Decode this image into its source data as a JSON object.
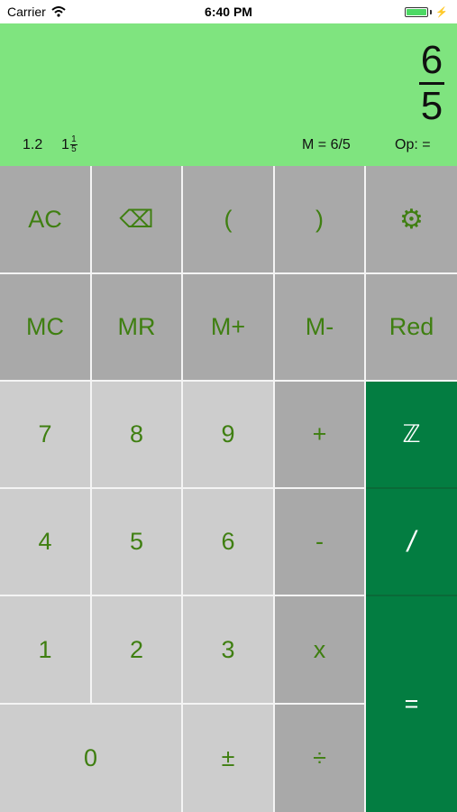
{
  "status_bar": {
    "carrier": "Carrier",
    "time": "6:40 PM"
  },
  "display": {
    "numerator": "6",
    "denominator": "5",
    "decimal": "1.2",
    "mixed_whole": "1",
    "mixed_num": "1",
    "mixed_den": "5",
    "memory": "M = 6/5",
    "op": "Op: ="
  },
  "keys": {
    "ac": "AC",
    "backspace": "⌫",
    "lparen": "(",
    "rparen": ")",
    "settings": "⚙",
    "mc": "MC",
    "mr": "MR",
    "mplus": "M+",
    "mminus": "M-",
    "red": "Red",
    "k7": "7",
    "k8": "8",
    "k9": "9",
    "plus": "+",
    "integer": "ℤ",
    "k4": "4",
    "k5": "5",
    "k6": "6",
    "minus": "-",
    "fraction": "/",
    "k1": "1",
    "k2": "2",
    "k3": "3",
    "times": "x",
    "equals": "=",
    "k0": "0",
    "plusminus": "±",
    "divide": "÷"
  },
  "colors": {
    "display_bg": "#7fe47f",
    "key_dark": "#a9a9a9",
    "key_light": "#cdcdcd",
    "key_green": "#037d41",
    "key_text": "#3f7f11"
  }
}
